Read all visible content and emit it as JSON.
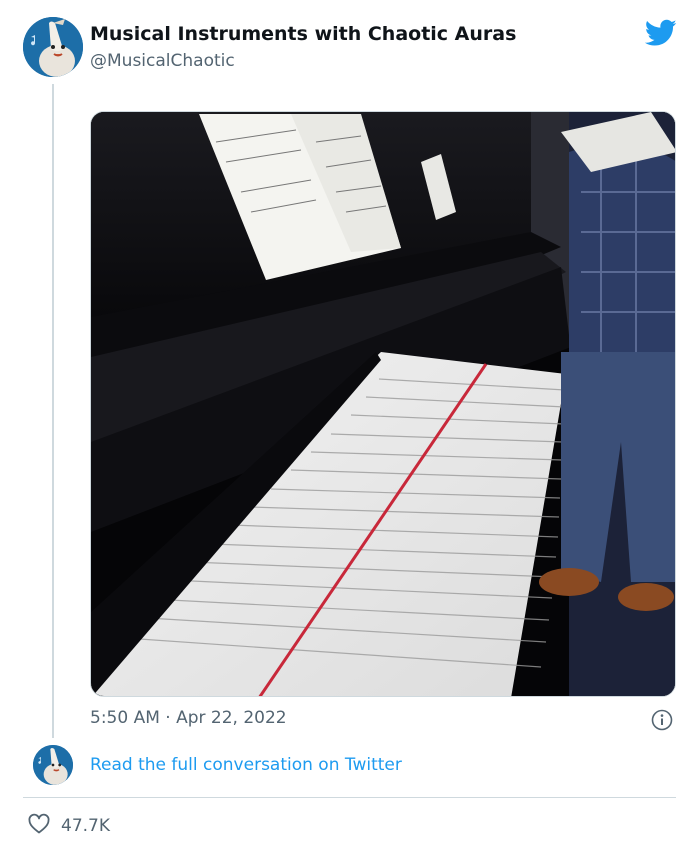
{
  "tweet": {
    "author_name": "Musical Instruments with Chaotic Auras",
    "author_handle": "@MusicalChaotic",
    "timestamp": "5:50 AM · Apr 22, 2022",
    "read_full_label": "Read the full conversation on Twitter",
    "like_count": "47.7K"
  },
  "icons": {
    "brand": "twitter-bird-icon",
    "info": "info-icon",
    "like": "heart-icon"
  },
  "colors": {
    "link": "#1d9bf0",
    "secondary_text": "#536471",
    "avatar_bg": "#1d6ea8",
    "twitter_blue": "#1d9bf0"
  }
}
